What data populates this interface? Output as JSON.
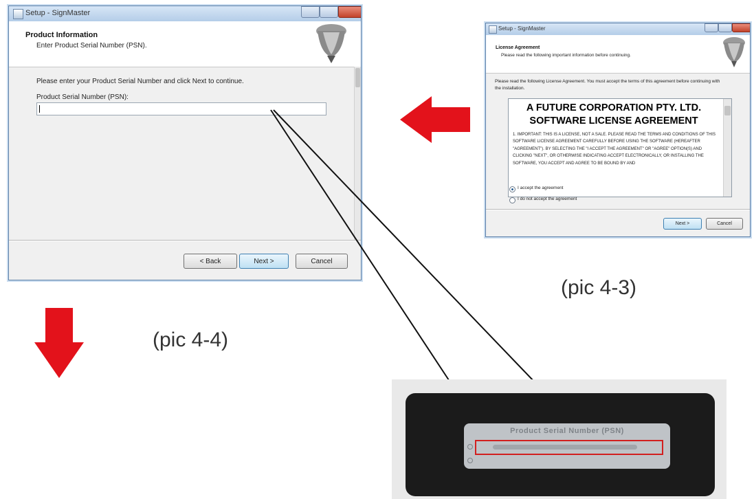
{
  "main_window": {
    "title": "Setup - SignMaster",
    "header_title": "Product Information",
    "header_subtitle": "Enter Product Serial Number (PSN).",
    "instruction": "Please enter your Product Serial Number and click Next to continue.",
    "field_label": "Product Serial Number (PSN):",
    "field_value": "",
    "buttons": {
      "back": "< Back",
      "next": "Next >",
      "cancel": "Cancel"
    }
  },
  "license_window": {
    "title": "Setup - SignMaster",
    "header_title": "License Agreement",
    "header_subtitle": "Please read the following important information before continuing.",
    "intro": "Please read the following License Agreement. You must accept the terms of this agreement before continuing with the installation.",
    "license_heading_1": "A FUTURE CORPORATION PTY. LTD.",
    "license_heading_2": "SOFTWARE LICENSE AGREEMENT",
    "license_text": "1. IMPORTANT: THIS IS A LICENSE, NOT A SALE. PLEASE READ THE TERMS AND CONDITIONS OF THIS SOFTWARE LICENSE AGREEMENT CAREFULLY BEFORE USING THE SOFTWARE (HEREAFTER \"AGREEMENT\"). BY SELECTING THE \"I ACCEPT THE AGREEMENT\" OR \"AGREE\" OPTION(S) AND CLICKING \"NEXT\", OR OTHERWISE INDICATING ACCEPT ELECTRONICALLY, OR INSTALLING THE SOFTWARE, YOU ACCEPT AND AGREE TO BE BOUND BY AND",
    "radio_accept": "I accept the agreement",
    "radio_decline": "I do not accept the agreement",
    "buttons": {
      "next": "Next >",
      "cancel": "Cancel"
    }
  },
  "captions": {
    "pic_4_3": "(pic 4-3)",
    "pic_4_4": "(pic 4-4)"
  },
  "label_photo": {
    "sticker_title": "Product Serial Number (PSN)"
  },
  "colors": {
    "arrow_red": "#e3121b",
    "highlight_red": "#d21f1f",
    "title_bar": "#c5d9ef"
  }
}
